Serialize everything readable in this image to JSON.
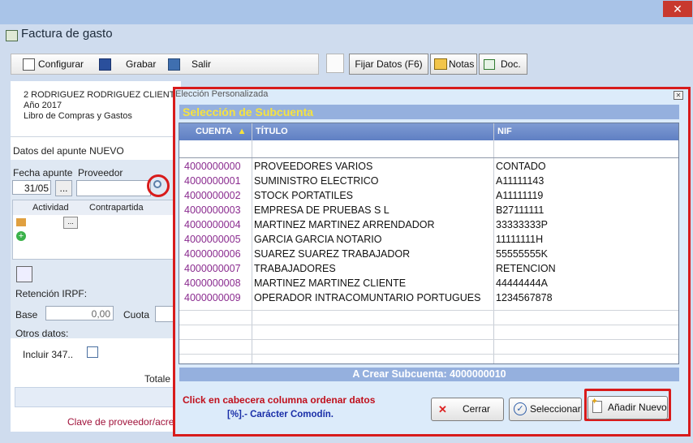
{
  "form": {
    "title": "Factura de gasto",
    "toolbar": {
      "configurar": "Configurar",
      "grabar": "Grabar",
      "salir": "Salir"
    },
    "fijar_datos": "Fijar Datos (F6)",
    "notas": "Notas",
    "doc": "Doc.",
    "client_info": [
      "2 RODRIGUEZ RODRIGUEZ CLIENTE",
      "Año 2017",
      "Libro de Compras y Gastos"
    ],
    "datos_apunte": "Datos del apunte NUEVO",
    "fecha_label": "Fecha apunte",
    "proveedor_label": "Proveedor",
    "fecha_value": "31/05",
    "dots": "...",
    "col_actividad": "Actividad",
    "col_contrapartida": "Contrapartida",
    "retencion_label": "Retención IRPF:",
    "base_label": "Base",
    "base_value": "0,00",
    "cuota_label": "Cuota",
    "otros_label": "Otros datos:",
    "incluir_label": "Incluir 347..",
    "totales_label": "Totale",
    "status_text": "Clave de proveedor/acre"
  },
  "dialog": {
    "title": "Elección Personalizada",
    "header": "Selección de Subcuenta",
    "columns": {
      "cuenta": "CUENTA",
      "titulo": "TÍTULO",
      "nif": "NIF"
    },
    "sort_icon": "sort-up-arrow",
    "rows": [
      {
        "cuenta": "4000000000",
        "titulo": "PROVEEDORES VARIOS",
        "nif": "CONTADO"
      },
      {
        "cuenta": "4000000001",
        "titulo": "SUMINISTRO ELECTRICO",
        "nif": "A11111143"
      },
      {
        "cuenta": "4000000002",
        "titulo": "STOCK PORTATILES",
        "nif": "A11111119"
      },
      {
        "cuenta": "4000000003",
        "titulo": "EMPRESA DE PRUEBAS S L",
        "nif": "B27111111"
      },
      {
        "cuenta": "4000000004",
        "titulo": "MARTINEZ MARTINEZ ARRENDADOR",
        "nif": "33333333P"
      },
      {
        "cuenta": "4000000005",
        "titulo": "GARCIA GARCIA NOTARIO",
        "nif": "11111111H"
      },
      {
        "cuenta": "4000000006",
        "titulo": "SUAREZ SUAREZ TRABAJADOR",
        "nif": "55555555K"
      },
      {
        "cuenta": "4000000007",
        "titulo": "TRABAJADORES",
        "nif": "RETENCION"
      },
      {
        "cuenta": "4000000008",
        "titulo": "MARTINEZ MARTINEZ CLIENTE",
        "nif": "44444444A"
      },
      {
        "cuenta": "4000000009",
        "titulo": "OPERADOR INTRACOMUNTARIO PORTUGUES",
        "nif": "1234567878"
      }
    ],
    "create_label": "A Crear Subcuenta: 4000000010",
    "hint_line1": "Click en cabecera columna ordenar datos",
    "hint_line2": "[%].- Carácter Comodín.",
    "btn_cerrar": "Cerrar",
    "btn_seleccionar": "Seleccionar",
    "btn_anadir": "Añadir Nuevo"
  },
  "colors": {
    "accent_red": "#d81b1b",
    "account_purple": "#8a2b8f",
    "header_blue": "#95b0de",
    "hint_red": "#c0101c",
    "hint_blue": "#1a2fa8"
  }
}
